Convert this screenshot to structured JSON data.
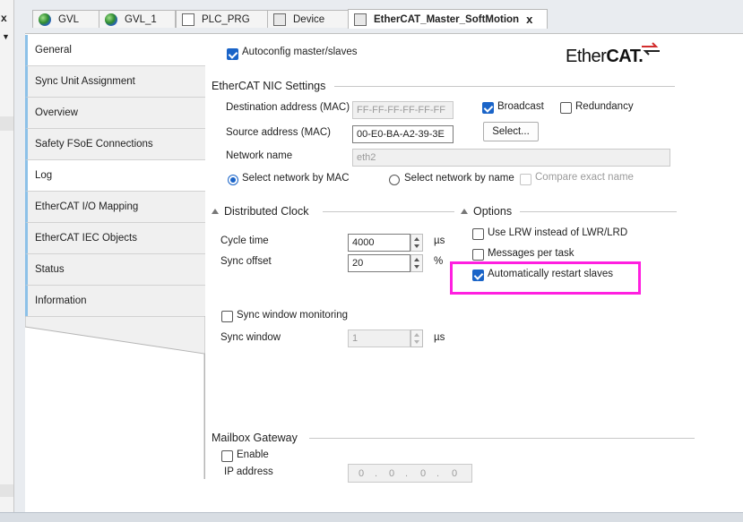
{
  "tabs": [
    {
      "label": "GVL",
      "icon": "globe-icon"
    },
    {
      "label": "GVL_1",
      "icon": "globe-icon"
    },
    {
      "label": "PLC_PRG",
      "icon": "program-icon"
    },
    {
      "label": "Device",
      "icon": "device-icon"
    },
    {
      "label": "EtherCAT_Master_SoftMotion",
      "icon": "device-icon",
      "close": "x",
      "active": true
    }
  ],
  "left_panel": {
    "close": "x",
    "dropdown": "▼"
  },
  "nav": {
    "items": [
      "General",
      "Sync Unit Assignment",
      "Overview",
      "Safety FSoE Connections",
      "Log",
      "EtherCAT I/O Mapping",
      "EtherCAT IEC Objects",
      "Status",
      "Information"
    ],
    "selected_index": 4
  },
  "general": {
    "autoconfig_label": "Autoconfig master/slaves",
    "autoconfig_checked": true,
    "logo_left": "Ether",
    "logo_right": "CAT."
  },
  "nic": {
    "title": "EtherCAT NIC Settings",
    "dest_label": "Destination address (MAC)",
    "dest_value": "FF-FF-FF-FF-FF-FF",
    "broadcast_label": "Broadcast",
    "broadcast_checked": true,
    "redundancy_label": "Redundancy",
    "redundancy_checked": false,
    "source_label": "Source address (MAC)",
    "source_value": "00-E0-BA-A2-39-3E",
    "select_label": "Select...",
    "netname_label": "Network name",
    "netname_value": "eth2",
    "by_mac_label": "Select network by MAC",
    "by_name_label": "Select network by name",
    "compare_label": "Compare exact name"
  },
  "dc": {
    "title": "Distributed Clock",
    "cycle_label": "Cycle time",
    "cycle_value": "4000",
    "cycle_unit": "µs",
    "offset_label": "Sync offset",
    "offset_value": "20",
    "offset_unit": "%",
    "window_monitor_label": "Sync window monitoring",
    "window_label": "Sync window",
    "window_value": "1",
    "window_unit": "µs"
  },
  "options": {
    "title": "Options",
    "lrw_label": "Use LRW instead of LWR/LRD",
    "lrw_checked": false,
    "msgs_label": "Messages per task",
    "msgs_checked": false,
    "restart_label": "Automatically restart slaves",
    "restart_checked": true
  },
  "mailbox": {
    "title": "Mailbox Gateway",
    "enable_label": "Enable",
    "ip_label": "IP address",
    "ip_octets": [
      "0",
      "0",
      "0",
      "0"
    ],
    "ip_dots": [
      ".",
      ".",
      "."
    ]
  },
  "colors": {
    "accent": "#1a64c8",
    "highlight": "#ff1fe0",
    "logo_red": "#d22d2d"
  }
}
